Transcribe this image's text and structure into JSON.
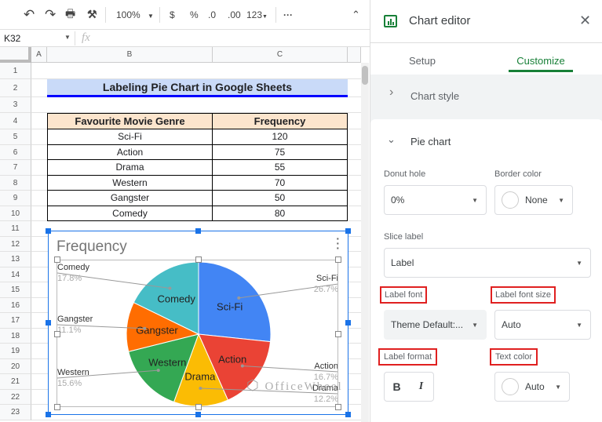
{
  "toolbar": {
    "zoom": "100%",
    "currency": "$",
    "percent": "%",
    "dec_less": ".0",
    "dec_more": ".00",
    "format": "123"
  },
  "formula_bar": {
    "cell_ref": "K32",
    "fx": "fx"
  },
  "columns": [
    "A",
    "B",
    "C"
  ],
  "rows": [
    "1",
    "2",
    "3",
    "4",
    "5",
    "6",
    "7",
    "8",
    "9",
    "10",
    "11",
    "12",
    "13",
    "14",
    "15",
    "16",
    "17",
    "18",
    "19",
    "20",
    "21",
    "22",
    "23"
  ],
  "sheet": {
    "title": "Labeling Pie Chart in Google Sheets",
    "headers": [
      "Favourite Movie Genre",
      "Frequency"
    ],
    "data": [
      [
        "Sci-Fi",
        "120"
      ],
      [
        "Action",
        "75"
      ],
      [
        "Drama",
        "55"
      ],
      [
        "Western",
        "70"
      ],
      [
        "Gangster",
        "50"
      ],
      [
        "Comedy",
        "80"
      ]
    ]
  },
  "chart_data": {
    "type": "pie",
    "title": "Frequency",
    "categories": [
      "Sci-Fi",
      "Action",
      "Drama",
      "Western",
      "Gangster",
      "Comedy"
    ],
    "values": [
      120,
      75,
      55,
      70,
      50,
      80
    ],
    "percent_labels": [
      "26.7%",
      "16.7%",
      "12.2%",
      "15.6%",
      "11.1%",
      "17.8%"
    ],
    "colors": [
      "#4285f4",
      "#ea4335",
      "#fbbc04",
      "#34a853",
      "#ff6d01",
      "#46bdc6"
    ],
    "slice_label": "Label"
  },
  "watermark": "OfficeWheel",
  "editor": {
    "title": "Chart editor",
    "tabs": [
      "Setup",
      "Customize"
    ],
    "active_tab": "Customize",
    "sections": [
      "Chart style",
      "Pie chart"
    ],
    "donut_hole_label": "Donut hole",
    "donut_hole": "0%",
    "border_color_label": "Border color",
    "border_color": "None",
    "slice_label_label": "Slice label",
    "slice_label": "Label",
    "label_font_label": "Label font",
    "label_font": "Theme Default:...",
    "label_font_size_label": "Label font size",
    "label_font_size": "Auto",
    "label_format_label": "Label format",
    "bold": "B",
    "italic": "I",
    "text_color_label": "Text color",
    "text_color": "Auto"
  }
}
